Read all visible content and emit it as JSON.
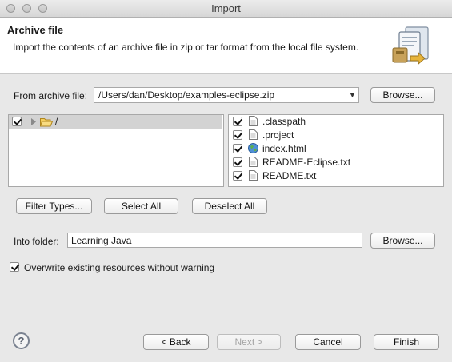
{
  "window": {
    "title": "Import"
  },
  "header": {
    "title": "Archive file",
    "description": "Import the contents of an archive file in zip or tar format from the local file system."
  },
  "archive": {
    "label": "From archive file:",
    "value": "/Users/dan/Desktop/examples-eclipse.zip",
    "browse_label": "Browse..."
  },
  "tree": {
    "root_label": "/",
    "checked": true
  },
  "files": [
    {
      "name": ".classpath",
      "icon": "text-file-icon",
      "checked": true
    },
    {
      "name": ".project",
      "icon": "text-file-icon",
      "checked": true
    },
    {
      "name": "index.html",
      "icon": "globe-icon",
      "checked": true
    },
    {
      "name": "README-Eclipse.txt",
      "icon": "text-file-icon",
      "checked": true
    },
    {
      "name": "README.txt",
      "icon": "text-file-icon",
      "checked": true
    }
  ],
  "selection_buttons": {
    "filter_types": "Filter Types...",
    "select_all": "Select All",
    "deselect_all": "Deselect All"
  },
  "into_folder": {
    "label": "Into folder:",
    "value": "Learning Java",
    "browse_label": "Browse..."
  },
  "overwrite": {
    "label": "Overwrite existing resources without warning",
    "checked": true
  },
  "footer": {
    "help": "?",
    "back": "< Back",
    "next": "Next >",
    "cancel": "Cancel",
    "finish": "Finish"
  }
}
